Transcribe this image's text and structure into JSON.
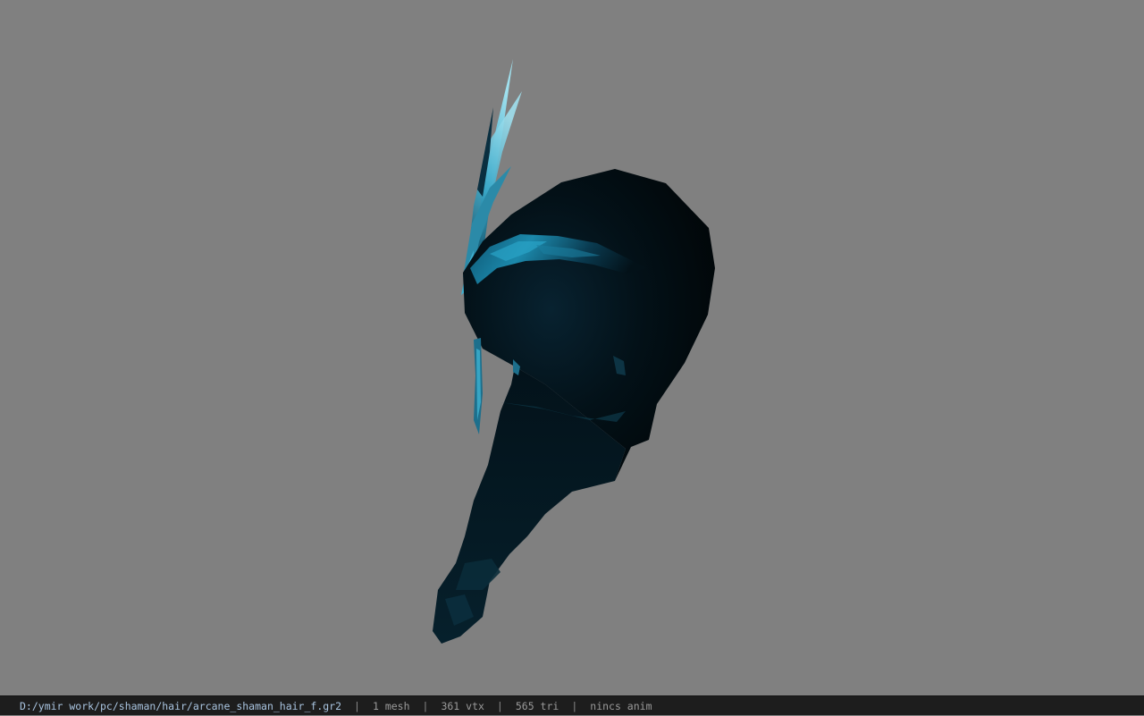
{
  "viewport": {
    "background_color": "#808080",
    "model_name": "arcane_shaman_hair_f",
    "model_colors": {
      "hair_dark": "#020b10",
      "hair_mid": "#061c26",
      "highlight": "#1e8fb0",
      "feather_light": "#6fc8dc"
    }
  },
  "status_bar": {
    "file_path": "D:/ymir work/pc/shaman/hair/arcane_shaman_hair_f.gr2",
    "separator": "|",
    "mesh_count": "1 mesh",
    "vertex_count": "361 vtx",
    "triangle_count": "565 tri",
    "anim_status": "nincs anim"
  }
}
